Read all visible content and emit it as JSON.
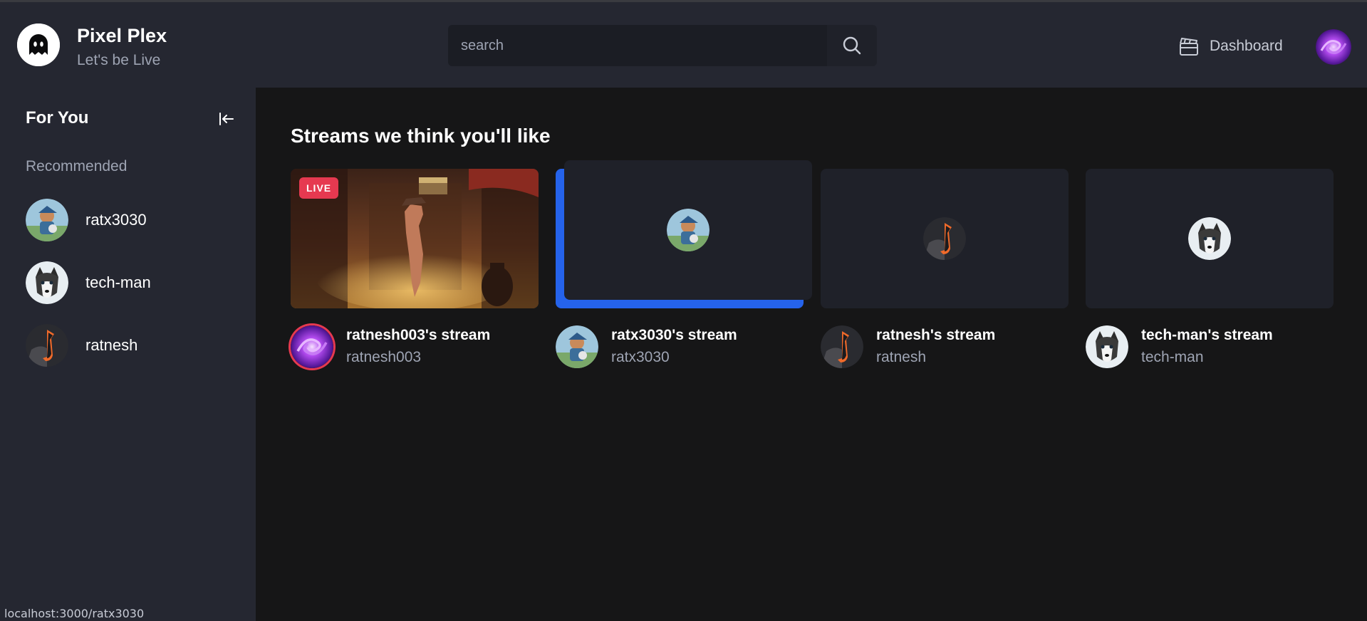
{
  "navbar": {
    "brand_title": "Pixel Plex",
    "brand_subtitle": "Let's be Live",
    "logo_icon": "ghost-logo-icon",
    "search_placeholder": "search",
    "search_icon": "search-icon",
    "dashboard_label": "Dashboard",
    "dashboard_icon": "clapperboard-icon"
  },
  "sidebar": {
    "title": "For You",
    "collapse_icon": "arrow-left-to-line-icon",
    "section_label": "Recommended",
    "items": [
      {
        "name": "ratx3030"
      },
      {
        "name": "tech-man"
      },
      {
        "name": "ratnesh"
      }
    ]
  },
  "main": {
    "heading": "Streams we think you'll like",
    "streams": [
      {
        "title": "ratnesh003's stream",
        "user": "ratnesh003",
        "live": true,
        "live_label": "LIVE"
      },
      {
        "title": "ratx3030's stream",
        "user": "ratx3030",
        "live": false
      },
      {
        "title": "ratnesh's stream",
        "user": "ratnesh",
        "live": false
      },
      {
        "title": "tech-man's stream",
        "user": "tech-man",
        "live": false
      }
    ]
  },
  "status_bar": {
    "url": "localhost:3000/ratx3030"
  },
  "colors": {
    "background": "#161617",
    "panel": "#252731",
    "accent": "#2563eb",
    "live": "#e63950",
    "muted_text": "#9ea4b3"
  }
}
